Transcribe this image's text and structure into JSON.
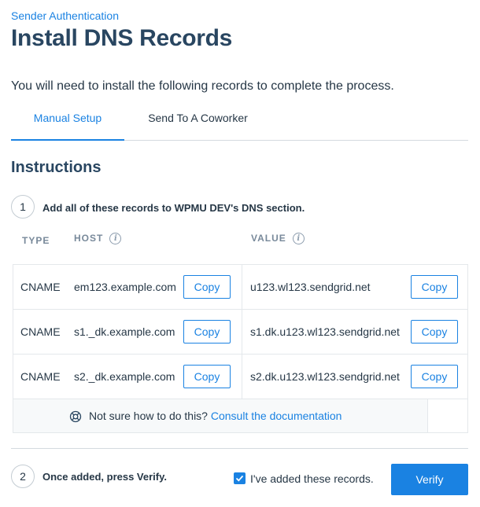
{
  "header": {
    "breadcrumb": "Sender Authentication",
    "title": "Install DNS Records",
    "intro": "You will need to install the following records to complete the process."
  },
  "tabs": [
    {
      "label": "Manual Setup",
      "active": true
    },
    {
      "label": "Send To A Coworker",
      "active": false
    }
  ],
  "instructions": {
    "title": "Instructions",
    "step1": {
      "number": "1",
      "text": "Add all of these records to WPMU DEV's DNS section."
    },
    "step2": {
      "number": "2",
      "text": "Once added, press Verify."
    }
  },
  "table": {
    "headers": {
      "type": "TYPE",
      "host": "HOST",
      "value": "VALUE"
    },
    "copy_label": "Copy",
    "rows": [
      {
        "type": "CNAME",
        "host": "em123.example.com",
        "value": "u123.wl123.sendgrid.net"
      },
      {
        "type": "CNAME",
        "host": "s1._dk.example.com",
        "value": "s1.dk.u123.wl123.sendgrid.net"
      },
      {
        "type": "CNAME",
        "host": "s2._dk.example.com",
        "value": "s2.dk.u123.wl123.sendgrid.net"
      }
    ]
  },
  "help": {
    "text": "Not sure how to do this?",
    "link": "Consult the documentation"
  },
  "footer": {
    "checkbox_label": "I've added these records.",
    "checkbox_checked": true,
    "verify_label": "Verify"
  },
  "colors": {
    "accent": "#1a82e2",
    "heading": "#294661",
    "muted": "#78899a"
  },
  "icons": {
    "info": "info-icon",
    "help": "lifebuoy-icon",
    "check": "checkmark-icon"
  }
}
